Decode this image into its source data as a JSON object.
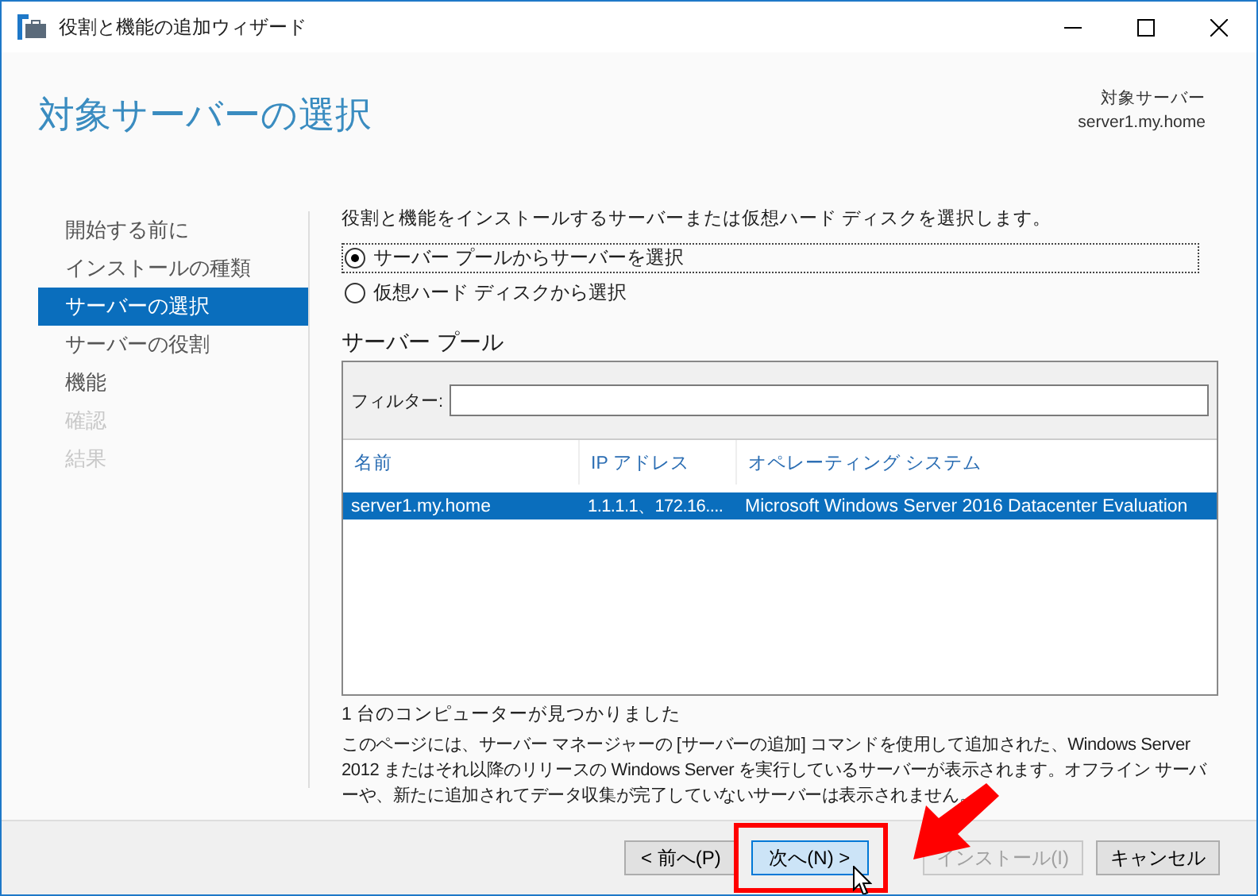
{
  "window": {
    "title": "役割と機能の追加ウィザード"
  },
  "header": {
    "title": "対象サーバーの選択",
    "target_label": "対象サーバー",
    "target_value": "server1.my.home"
  },
  "nav": [
    {
      "label": "開始する前に",
      "selected": false,
      "disabled": false
    },
    {
      "label": "インストールの種類",
      "selected": false,
      "disabled": false
    },
    {
      "label": "サーバーの選択",
      "selected": true,
      "disabled": false
    },
    {
      "label": "サーバーの役割",
      "selected": false,
      "disabled": false
    },
    {
      "label": "機能",
      "selected": false,
      "disabled": false
    },
    {
      "label": "確認",
      "selected": false,
      "disabled": true
    },
    {
      "label": "結果",
      "selected": false,
      "disabled": true
    }
  ],
  "intro": "役割と機能をインストールするサーバーまたは仮想ハード ディスクを選択します。",
  "options": [
    {
      "label": "サーバー プールからサーバーを選択",
      "selected": true
    },
    {
      "label": "仮想ハード ディスクから選択",
      "selected": false
    }
  ],
  "pool": {
    "title": "サーバー プール",
    "filter_label": "フィルター:",
    "columns": [
      "名前",
      "IP アドレス",
      "オペレーティング システム"
    ],
    "rows": [
      {
        "cells": [
          "server1.my.home",
          "1.1.1.1、172.16....",
          "Microsoft Windows Server 2016 Datacenter Evaluation"
        ],
        "selected": true
      }
    ]
  },
  "count": "1 台のコンピューターが見つかりました",
  "description": "このページには、サーバー マネージャーの [サーバーの追加] コマンドを使用して追加された、Windows Server 2012 またはそれ以降のリリースの Windows Server を実行しているサーバーが表示されます。オフライン サーバーや、新たに追加されてデータ収集が完了していないサーバーは表示されません。",
  "buttons": [
    {
      "label": "< 前へ(P)",
      "disabled": false,
      "default": false
    },
    {
      "label": "次へ(N) >",
      "disabled": false,
      "default": true
    },
    {
      "label": "インストール(I)",
      "disabled": true,
      "default": false
    },
    {
      "label": "キャンセル",
      "disabled": false,
      "default": false
    }
  ]
}
